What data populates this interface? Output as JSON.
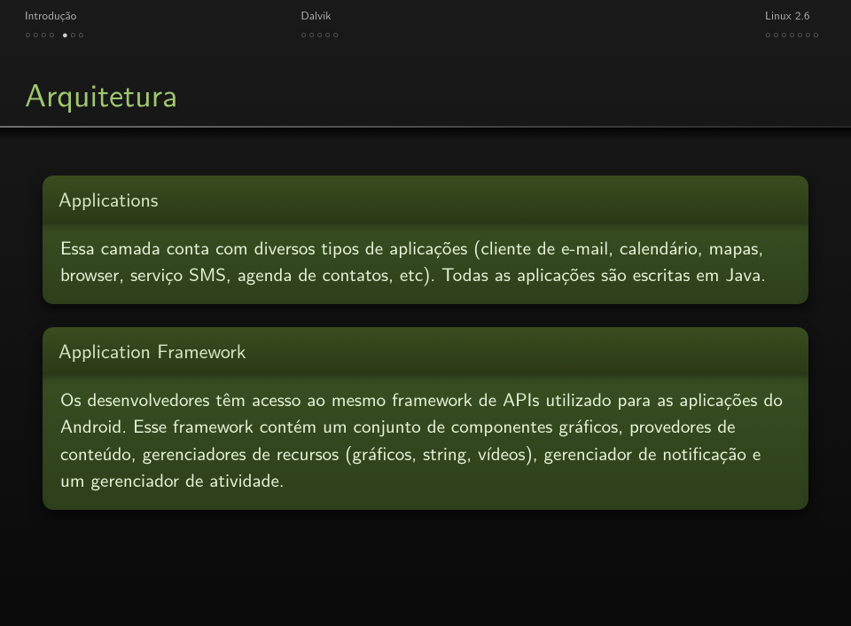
{
  "nav": {
    "left": {
      "title": "Introdução",
      "dots": [
        [
          0,
          0,
          0,
          0
        ],
        [
          1,
          0,
          0
        ]
      ]
    },
    "middle": {
      "title": "Dalvik",
      "dots": [
        [
          0,
          0,
          0,
          0,
          0
        ]
      ]
    },
    "right": {
      "title": "Linux 2.6",
      "dots": [
        [
          0,
          0,
          0,
          0,
          0,
          0,
          0
        ]
      ]
    }
  },
  "title": "Arquitetura",
  "blocks": [
    {
      "header": "Applications",
      "body": "Essa camada conta com diversos tipos de aplicações (cliente de e-mail, calendário, mapas, browser, serviço SMS, agenda de contatos, etc). Todas as aplicações são escritas em Java."
    },
    {
      "header": "Application Framework",
      "body": "Os desenvolvedores têm acesso ao mesmo framework de APIs utilizado para as aplicações do Android. Esse framework contém um conjunto de componentes gráficos, provedores de conteúdo, gerenciadores de recursos (gráficos, string, vídeos), gerenciador de notificação e um gerenciador de atividade."
    }
  ]
}
